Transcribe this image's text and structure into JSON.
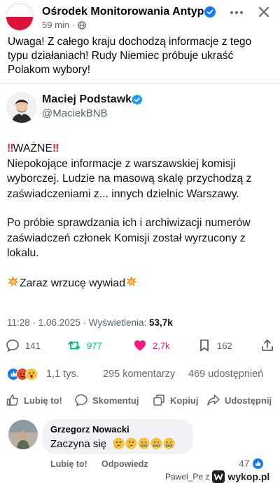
{
  "fb_post": {
    "page_name": "Ośrodek Monitorowania Antyp…",
    "time_ago": "59 min",
    "text": "Uwaga! Z całego kraju dochodzą informacje z tego typu działaniach! Rudy Niemiec próbuje ukraść Polakom wybory!"
  },
  "tweet": {
    "author_name": "Maciej Podstawka",
    "handle": "@MaciekBNB",
    "headline": "WAŻNE",
    "paragraph1": "Niepokojące informacje z warszawskiej komisji wyborczej. Ludzie na masową skalę przychodzą z zaświadczeniami z... innych dzielnic Warszawy.",
    "paragraph2": "Po próbie sprawdzania ich i archiwizacji numerów zaświadczeń członek Komisji został wyrzucony z lokalu.",
    "paragraph3": "Zaraz wrzucę wywiad",
    "timestamp": "11:28 · 1.06.2025 · Wyświetlenia: ",
    "views": "53,7k",
    "metrics": {
      "replies": "141",
      "retweets": "977",
      "likes": "2,7k",
      "bookmarks": "162"
    }
  },
  "reactions": {
    "count": "1,1 tys.",
    "comments": "295 komentarzy",
    "shares": "469 udostępnień"
  },
  "actions": {
    "like": "Lubię to!",
    "comment": "Skomentuj",
    "copy": "Kopiuj",
    "share": "Udostępnij"
  },
  "comment": {
    "author": "Grzegorz Nowacki",
    "text": "Zaczyna się",
    "like_label": "Lubię to!",
    "reply_label": "Odpowiedz",
    "like_count": "47"
  },
  "watermark": {
    "user": "Pawel_Pe z",
    "site": "wykop.pl"
  },
  "colors": {
    "fb_blue": "#1877f2",
    "x_blue": "#1d9bf0",
    "retweet_green": "#00ba7c",
    "like_pink": "#f91880"
  }
}
